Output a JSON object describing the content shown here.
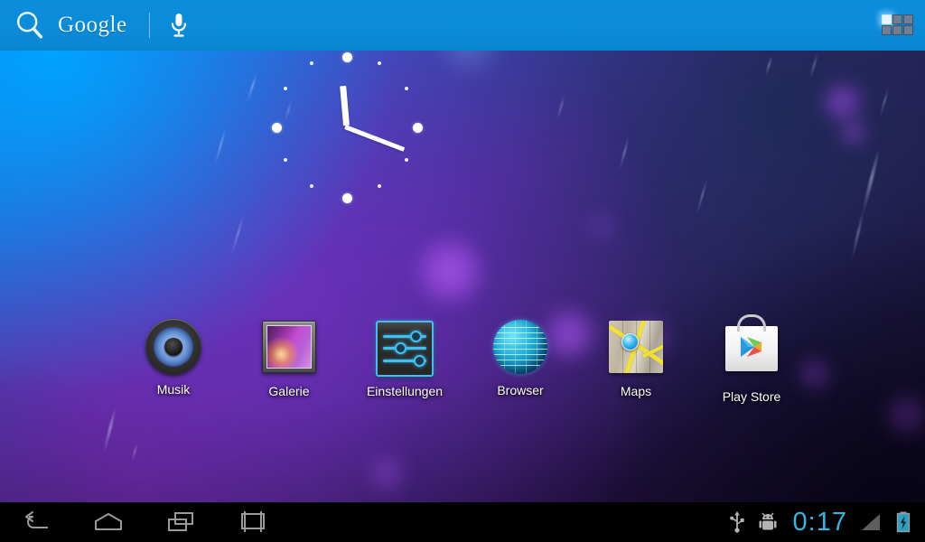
{
  "search": {
    "brand": "Google",
    "search_icon": "search-icon",
    "mic_icon": "microphone-icon",
    "apps_icon": "apps-grid-icon",
    "bar_color": "#0b8dd6"
  },
  "widget": {
    "name": "analog-clock-widget",
    "hour_hand_angle": -5,
    "minute_hand_angle": 21,
    "hour_marks": 12,
    "major_marks": [
      12,
      3,
      6,
      9
    ]
  },
  "dock": {
    "apps": [
      {
        "label": "Musik",
        "icon": "music-speaker-icon"
      },
      {
        "label": "Galerie",
        "icon": "gallery-frame-icon"
      },
      {
        "label": "Einstellungen",
        "icon": "settings-sliders-icon"
      },
      {
        "label": "Browser",
        "icon": "browser-globe-icon"
      },
      {
        "label": "Maps",
        "icon": "maps-folded-map-icon"
      },
      {
        "label": "Play Store",
        "icon": "play-store-bag-icon"
      }
    ]
  },
  "navbar": {
    "buttons": [
      {
        "name": "back-button",
        "icon": "back-arrow-icon"
      },
      {
        "name": "home-button",
        "icon": "home-icon"
      },
      {
        "name": "recents-button",
        "icon": "recent-apps-icon"
      },
      {
        "name": "screenshot-button",
        "icon": "screenshot-icon"
      }
    ],
    "status": {
      "usb_icon": "usb-icon",
      "debug_icon": "android-debug-icon",
      "clock": "0:17",
      "clock_color": "#33b5e5",
      "signal_icon": "signal-bars-icon",
      "battery_icon": "battery-charging-icon"
    }
  }
}
